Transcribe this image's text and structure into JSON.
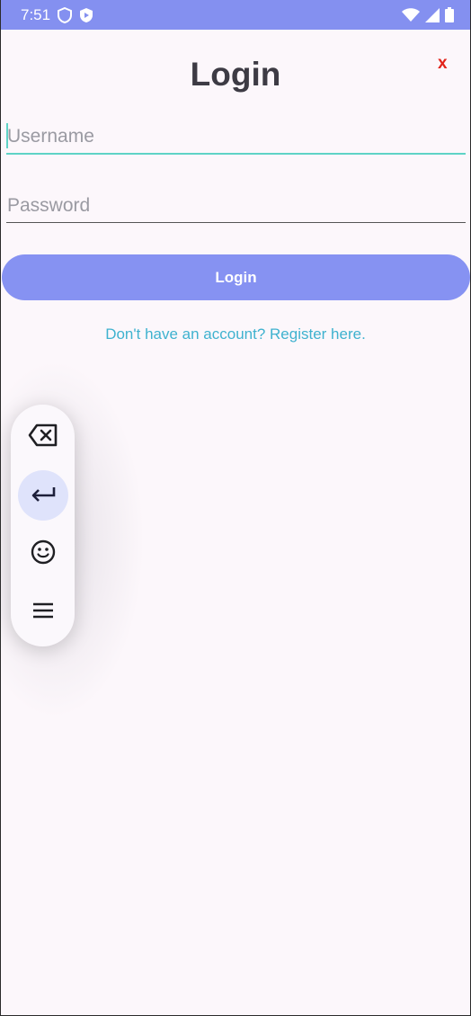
{
  "status_bar": {
    "time": "7:51",
    "left_icons": [
      "shield-icon",
      "play-badge-icon"
    ],
    "right_icons": [
      "wifi-icon",
      "signal-icon",
      "battery-icon"
    ],
    "color": "#8490f0"
  },
  "header": {
    "title": "Login",
    "close_label": "x"
  },
  "form": {
    "username_placeholder": "Username",
    "password_placeholder": "Password",
    "login_label": "Login",
    "register_text": "Don't have an account? Register here."
  },
  "floating_toolbar": {
    "items": [
      {
        "icon": "backspace-icon"
      },
      {
        "icon": "enter-icon",
        "active": true
      },
      {
        "icon": "emoji-icon"
      },
      {
        "icon": "menu-icon"
      }
    ]
  },
  "colors": {
    "accent": "#8692f2",
    "focus": "#5fd3c6",
    "link": "#3fb2cf",
    "close": "#e2231a",
    "background": "#fcf7fb"
  }
}
